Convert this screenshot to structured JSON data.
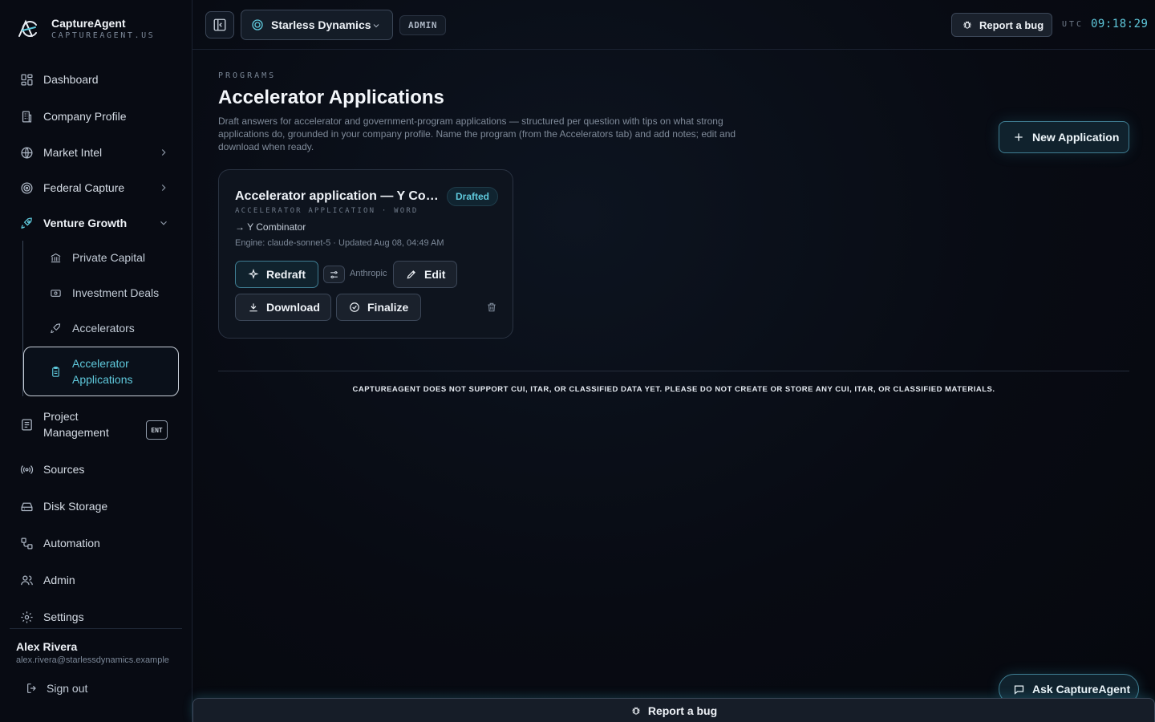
{
  "brand": {
    "name": "CaptureAgent",
    "domain": "CAPTUREAGENT.US",
    "accent": "#5fc9dc"
  },
  "sidebar": {
    "items": [
      {
        "label": "Dashboard",
        "icon": "dashboard-icon"
      },
      {
        "label": "Company Profile",
        "icon": "building-icon"
      },
      {
        "label": "Market Intel",
        "icon": "globe-icon",
        "expandable": true
      },
      {
        "label": "Federal Capture",
        "icon": "target-icon",
        "expandable": true
      },
      {
        "label": "Venture Growth",
        "icon": "rocket-icon",
        "expanded": true
      },
      {
        "label": "Project Management",
        "icon": "clipboard-icon",
        "badge": "ENT"
      },
      {
        "label": "Sources",
        "icon": "broadcast-icon"
      },
      {
        "label": "Disk Storage",
        "icon": "disk-icon"
      },
      {
        "label": "Automation",
        "icon": "workflow-icon"
      },
      {
        "label": "Admin",
        "icon": "users-icon"
      },
      {
        "label": "Settings",
        "icon": "gear-icon"
      }
    ],
    "venture_sub": [
      {
        "label": "Private Capital",
        "icon": "bank-icon"
      },
      {
        "label": "Investment Deals",
        "icon": "banknote-icon"
      },
      {
        "label": "Accelerators",
        "icon": "rocket-icon"
      },
      {
        "label": "Accelerator Applications",
        "icon": "clipboard-icon",
        "active": true
      }
    ],
    "user": {
      "name": "Alex Rivera",
      "email": "alex.rivera@starlessdynamics.example"
    },
    "signout": "Sign out"
  },
  "topbar": {
    "org": "Starless Dynamics",
    "role": "ADMIN",
    "report_bug": "Report a bug",
    "utc_label": "UTC",
    "utc_time": "09:18:29"
  },
  "main": {
    "eyebrow": "PROGRAMS",
    "title": "Accelerator Applications",
    "description": "Draft answers for accelerator and government-program applications — structured per question with tips on what strong applications do, grounded in your company profile. Name the program (from the Accelerators tab) and add notes; edit and download when ready.",
    "new_button": "New Application",
    "cards": [
      {
        "title": "Accelerator application — Y Combinator",
        "status": "Drafted",
        "meta": "ACCELERATOR APPLICATION · WORD",
        "program": "→ Y Combinator",
        "engine": "Engine: claude-sonnet-5 · Updated Aug 08, 04:49 AM",
        "provider": "Anthropic",
        "actions": {
          "redraft": "Redraft",
          "edit": "Edit",
          "download": "Download",
          "finalize": "Finalize"
        }
      }
    ],
    "disclaimer": "CAPTUREAGENT DOES NOT SUPPORT CUI, ITAR, OR CLASSIFIED DATA YET. PLEASE DO NOT CREATE OR STORE ANY CUI, ITAR, OR CLASSIFIED MATERIALS."
  },
  "ask_button": "Ask CaptureAgent",
  "bottom_bug": "Report a bug"
}
